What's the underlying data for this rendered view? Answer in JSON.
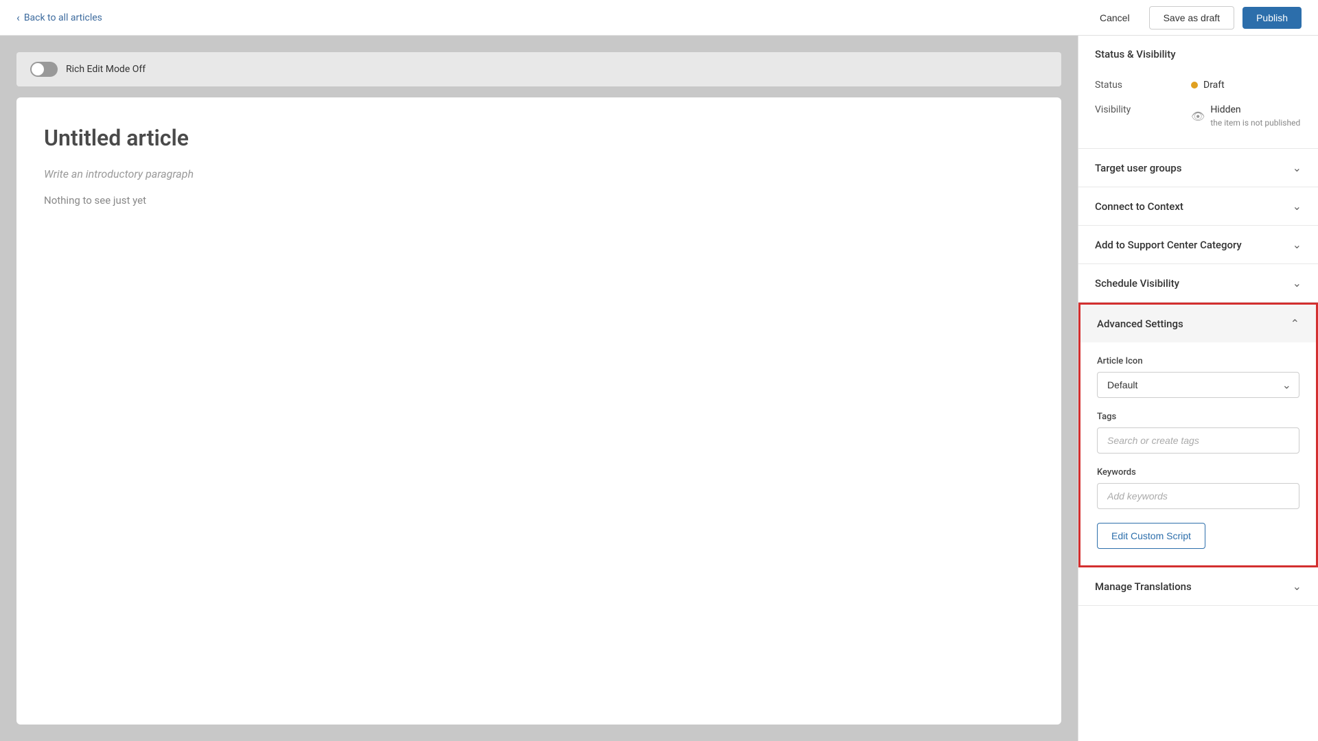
{
  "topbar": {
    "back_label": "Back to all articles",
    "cancel_label": "Cancel",
    "save_draft_label": "Save as draft",
    "publish_label": "Publish"
  },
  "editor": {
    "rich_edit_label": "Rich Edit Mode Off",
    "article_title": "Untitled article",
    "article_intro": "Write an introductory paragraph",
    "article_empty": "Nothing to see just yet"
  },
  "sidebar": {
    "status_visibility": {
      "section_title": "Status & Visibility",
      "status_label": "Status",
      "status_value": "Draft",
      "visibility_label": "Visibility",
      "visibility_value": "Hidden",
      "visibility_sub": "the item is not published"
    },
    "target_user_groups": {
      "section_title": "Target user groups"
    },
    "connect_to_context": {
      "section_title": "Connect to Context"
    },
    "add_to_category": {
      "section_title": "Add to Support Center Category"
    },
    "schedule_visibility": {
      "section_title": "Schedule Visibility"
    },
    "advanced_settings": {
      "section_title": "Advanced Settings",
      "article_icon_label": "Article Icon",
      "article_icon_default": "Default",
      "tags_label": "Tags",
      "tags_placeholder": "Search or create tags",
      "keywords_label": "Keywords",
      "keywords_placeholder": "Add keywords",
      "edit_script_label": "Edit Custom Script"
    },
    "manage_translations": {
      "section_title": "Manage Translations"
    }
  },
  "icons": {
    "chevron_left": "‹",
    "chevron_down": "⌄",
    "chevron_up": "⌃",
    "eye_off": "👁",
    "toggle_off": "⊘"
  }
}
